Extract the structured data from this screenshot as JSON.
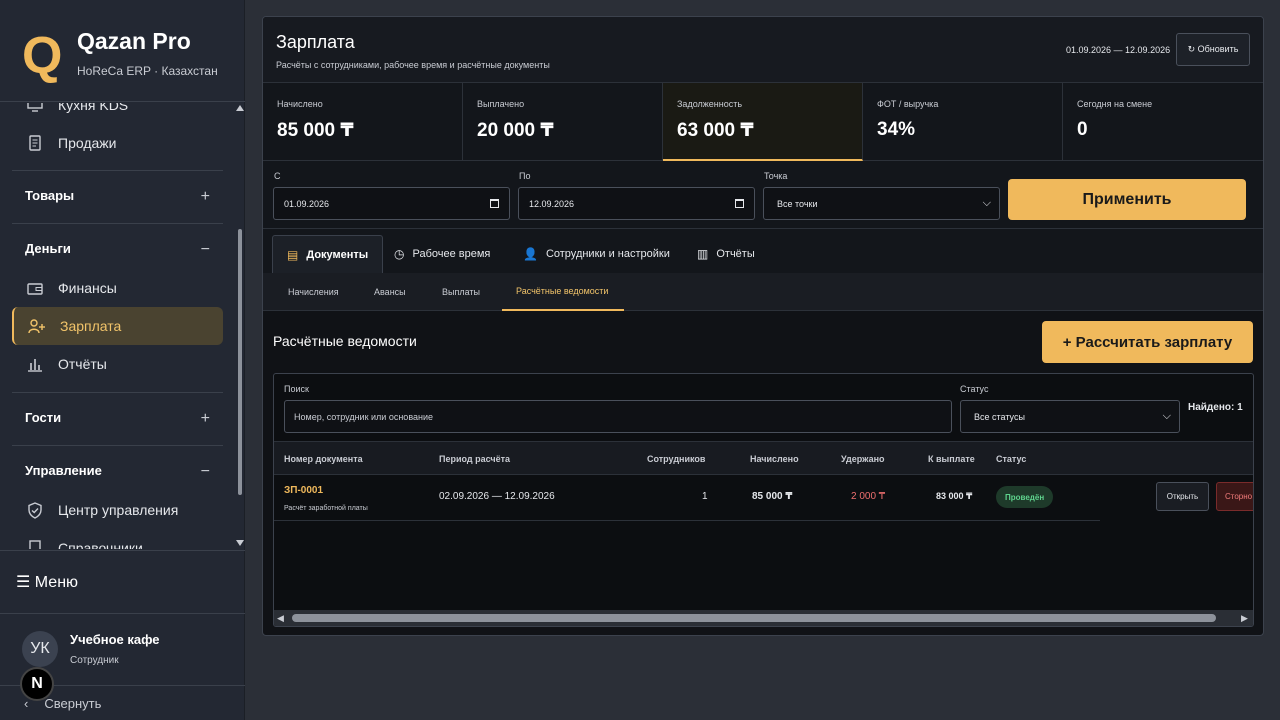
{
  "brand": {
    "logo_letter": "Q",
    "title": "Qazan Pro",
    "subtitle": "HoReCa ERP · Казахстан"
  },
  "sidebar": {
    "items": [
      {
        "label": "Кухня KDS",
        "icon": "monitor-icon"
      },
      {
        "label": "Продажи",
        "icon": "receipt-icon"
      },
      {
        "label": "Финансы",
        "icon": "wallet-icon"
      },
      {
        "label": "Зарплата",
        "icon": "user-plus-icon",
        "active": true
      },
      {
        "label": "Отчёты",
        "icon": "bar-chart-icon"
      },
      {
        "label": "Центр управления",
        "icon": "shield-check-icon"
      },
      {
        "label": "Справочники",
        "icon": "book-icon"
      }
    ],
    "groups": [
      {
        "label": "Товары",
        "sign": "+"
      },
      {
        "label": "Деньги",
        "sign": "−"
      },
      {
        "label": "Гости",
        "sign": "+"
      },
      {
        "label": "Управление",
        "sign": "−"
      }
    ],
    "menu_label": "☰ Меню",
    "user": {
      "initials": "УК",
      "name": "Учебное кафе",
      "role": "Сотрудник"
    },
    "badge_letter": "N",
    "collapse_label": "Свернуть",
    "collapse_arrow": "‹"
  },
  "header": {
    "title": "Зарплата",
    "subtitle": "Расчёты с сотрудниками, рабочее время и расчётные документы",
    "date_range": "01.09.2026 — 12.09.2026",
    "refresh_label": "↻ Обновить"
  },
  "kpis": [
    {
      "label": "Начислено",
      "value": "85 000 ₸"
    },
    {
      "label": "Выплачено",
      "value": "20 000 ₸"
    },
    {
      "label": "Задолженность",
      "value": "63 000 ₸"
    },
    {
      "label": "ФОТ / выручка",
      "value": "34%"
    },
    {
      "label": "Сегодня на смене",
      "value": "0"
    }
  ],
  "filters": {
    "from_label": "С",
    "from_value": "01.09.2026",
    "to_label": "По",
    "to_value": "12.09.2026",
    "point_label": "Точка",
    "point_value": "Все точки",
    "apply_label": "Применить"
  },
  "tabs": [
    {
      "label": "Документы",
      "icon": "▤"
    },
    {
      "label": "Рабочее время",
      "icon": "◷"
    },
    {
      "label": "Сотрудники и настройки",
      "icon": "👤"
    },
    {
      "label": "Отчёты",
      "icon": "▥"
    }
  ],
  "subtabs": [
    "Начисления",
    "Авансы",
    "Выплаты",
    "Расчётные ведомости"
  ],
  "section": {
    "title": "Расчётные ведомости",
    "calc_label": "+  Рассчитать зарплату"
  },
  "search": {
    "label": "Поиск",
    "placeholder": "Номер, сотрудник или основание",
    "status_label": "Статус",
    "status_value": "Все статусы",
    "found": "Найдено: 1"
  },
  "table": {
    "headers": [
      "Номер документа",
      "Период расчёта",
      "Сотрудников",
      "Начислено",
      "Удержано",
      "К выплате",
      "Статус"
    ],
    "rows": [
      {
        "doc_no": "ЗП-0001",
        "doc_sub": "Расчёт заработной платы",
        "period": "02.09.2026 — 12.09.2026",
        "employees": "1",
        "accrued": "85 000 ₸",
        "withheld": "2 000 ₸",
        "payout": "83 000 ₸",
        "status": "Проведён",
        "open_label": "Открыть",
        "storno_label": "Сторно"
      }
    ]
  }
}
